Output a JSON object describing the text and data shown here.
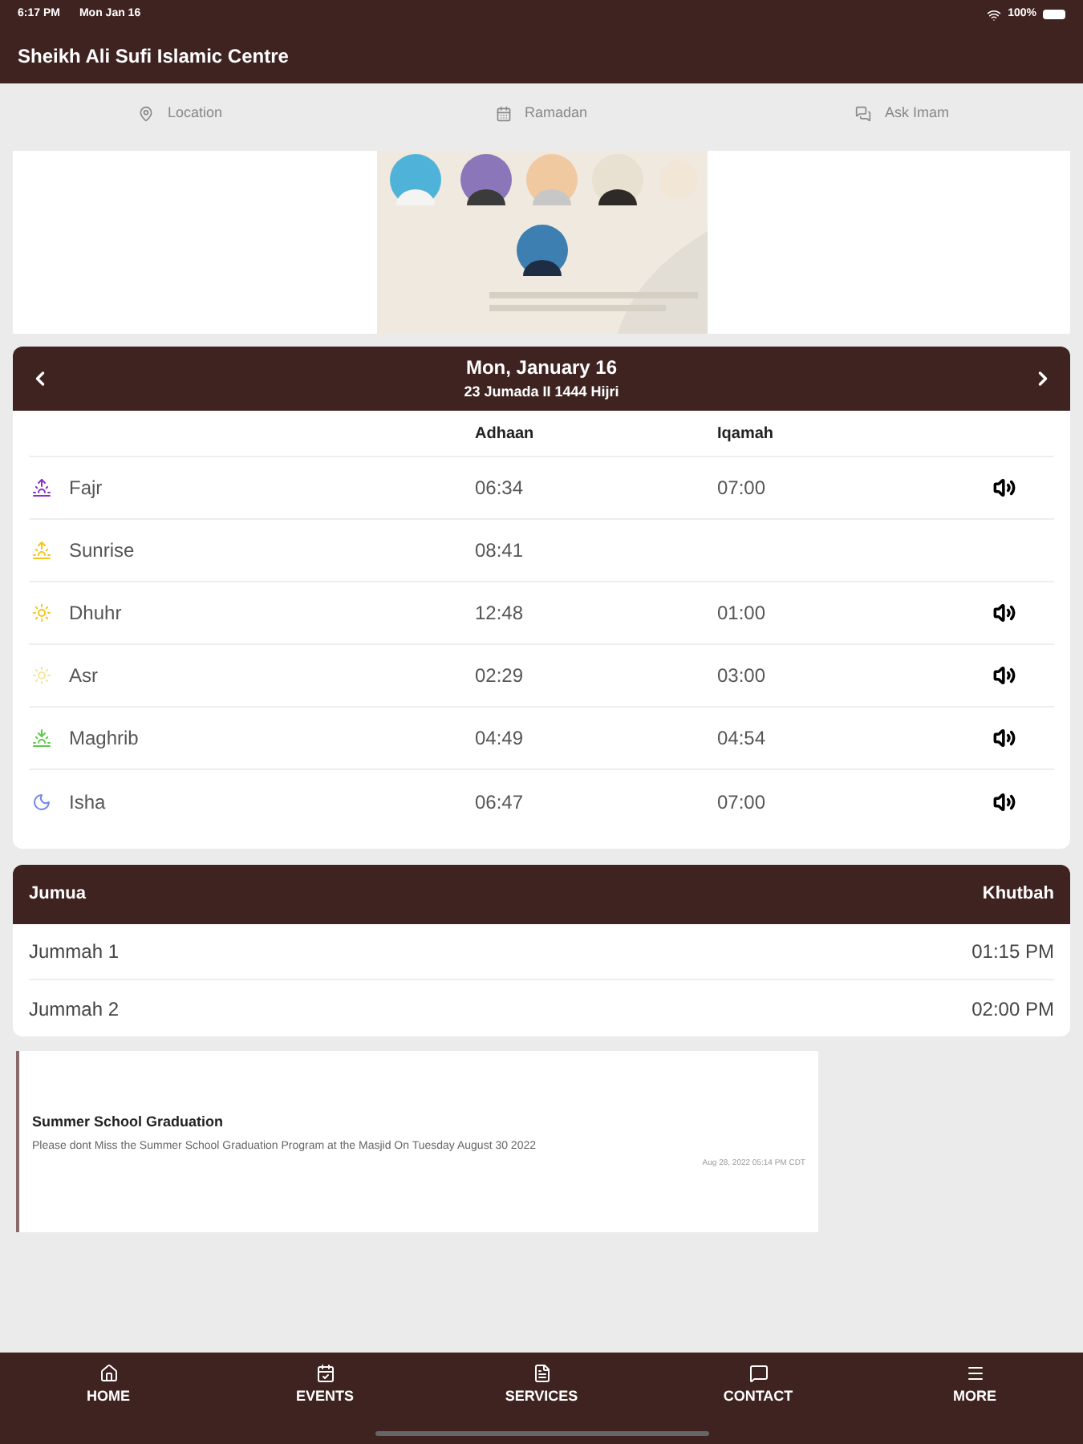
{
  "status_bar": {
    "time": "6:17 PM",
    "date": "Mon Jan 16",
    "battery": "100%"
  },
  "header": {
    "title": "Sheikh Ali Sufi Islamic Centre"
  },
  "quick_links": [
    {
      "kind": "location",
      "label": "Location"
    },
    {
      "kind": "ramadan",
      "label": "Ramadan"
    },
    {
      "kind": "chat",
      "label": "Ask Imam"
    }
  ],
  "prayer_card": {
    "date": "Mon, January 16",
    "hijri": "23 Jumada II 1444 Hijri",
    "columns": [
      "Adhaan",
      "Iqamah"
    ],
    "rows": [
      {
        "kind": "fajr",
        "name": "Fajr",
        "adhaan": "06:34",
        "iqamah": "07:00",
        "sound": true
      },
      {
        "kind": "sunrise",
        "name": "Sunrise",
        "adhaan": "08:41",
        "sound": false
      },
      {
        "kind": "dhuhr",
        "name": "Dhuhr",
        "adhaan": "12:48",
        "iqamah": "01:00",
        "sound": true
      },
      {
        "kind": "asr",
        "name": "Asr",
        "adhaan": "02:29",
        "iqamah": "03:00",
        "sound": true
      },
      {
        "kind": "maghrib",
        "name": "Maghrib",
        "adhaan": "04:49",
        "iqamah": "04:54",
        "sound": true
      },
      {
        "kind": "isha",
        "name": "Isha",
        "adhaan": "06:47",
        "iqamah": "07:00",
        "sound": true
      }
    ]
  },
  "jumua": {
    "columns": [
      "Jumua",
      "Khutbah"
    ],
    "rows": [
      {
        "name": "Jummah 1",
        "time": "01:15 PM"
      },
      {
        "name": "Jummah 2",
        "time": "02:00 PM"
      }
    ]
  },
  "announcement": {
    "title": "Summer School Graduation",
    "body": "Please dont Miss the Summer School Graduation Program at the Masjid On Tuesday August 30 2022",
    "timestamp": "Aug 28, 2022 05:14 PM CDT"
  },
  "tab_bar": [
    {
      "kind": "home",
      "label": "HOME"
    },
    {
      "kind": "events",
      "label": "EVENTS"
    },
    {
      "kind": "services",
      "label": "SERVICES"
    },
    {
      "kind": "contact",
      "label": "CONTACT"
    },
    {
      "kind": "more",
      "label": "MORE"
    }
  ]
}
